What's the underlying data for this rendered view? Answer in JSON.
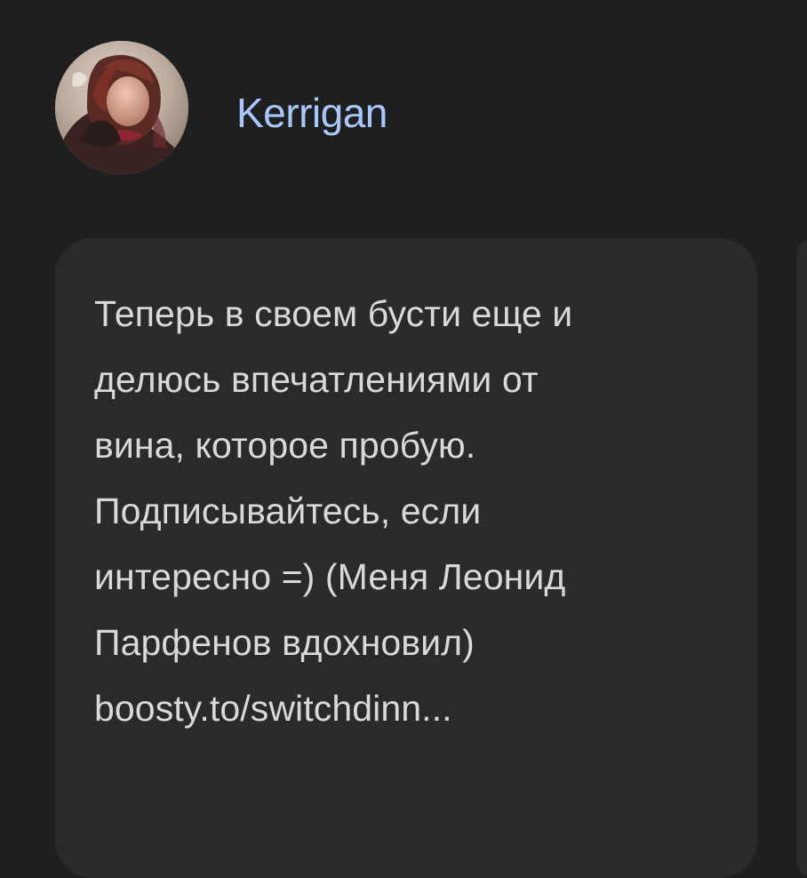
{
  "post": {
    "author": "Kerrigan",
    "text": "Теперь в своем бусти еще и\nделюсь впечатлениями от\nвина, которое пробую.\nПодписывайтесь, если\nинтересно =) (Меня Леонид\nПарфенов вдохновил)\nboosty.to/switchdinn..."
  },
  "colors": {
    "background": "#1f1f1f",
    "card": "#2a2a2a",
    "author": "#a8c7fa",
    "text": "#d9d9d9"
  },
  "icons": {
    "avatar": "profile-photo"
  }
}
